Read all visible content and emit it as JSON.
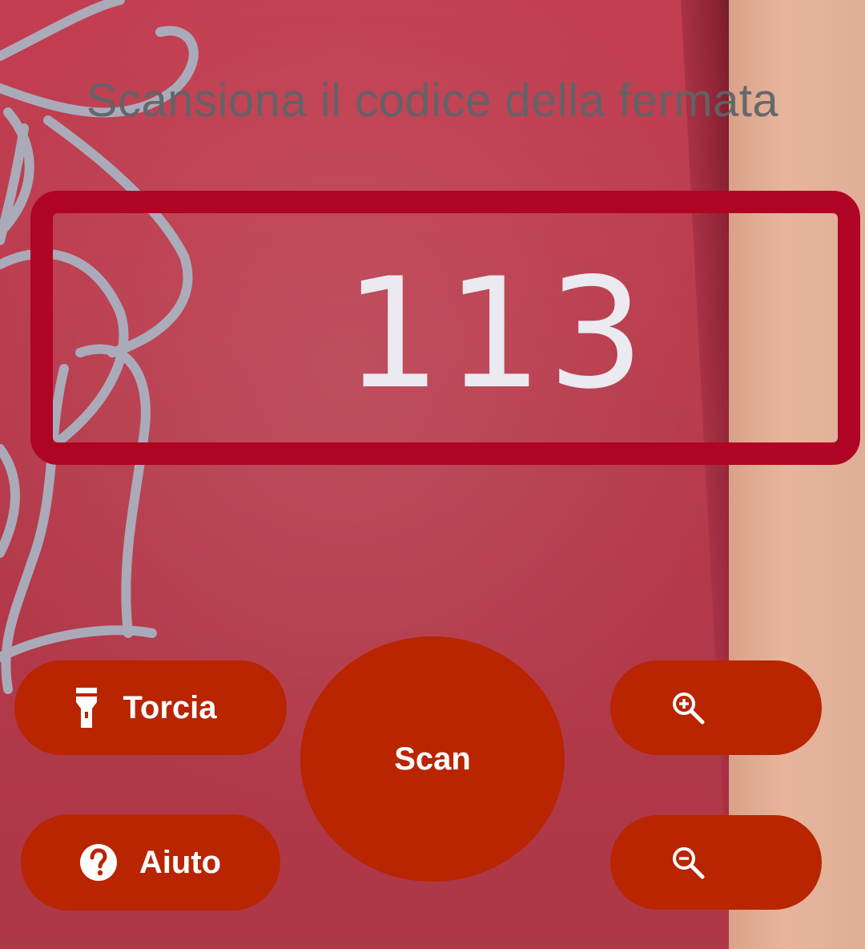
{
  "screen": {
    "instruction": "Scansiona il codice della fermata",
    "detected_code": "113"
  },
  "controls": {
    "torch": {
      "label": "Torcia",
      "icon": "flashlight-icon"
    },
    "help": {
      "label": "Aiuto",
      "icon": "help-circle-icon"
    },
    "scan": {
      "label": "Scan"
    },
    "zoom_in": {
      "icon": "zoom-in-icon"
    },
    "zoom_out": {
      "icon": "zoom-out-icon"
    }
  },
  "colors": {
    "accent": "#b82500",
    "frame": "#b00424",
    "title_text": "#5f6468"
  }
}
